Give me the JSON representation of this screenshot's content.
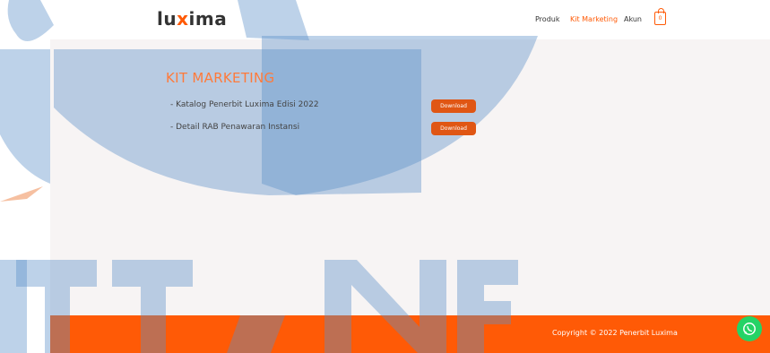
{
  "header": {
    "logo": {
      "prefix": "lu",
      "mark": "x",
      "suffix": "ima"
    },
    "nav": [
      {
        "label": "Produk"
      },
      {
        "label": "Kit Marketing"
      },
      {
        "label": "Akun"
      }
    ],
    "cart_count": "0"
  },
  "main": {
    "title": "KIT MARKETING",
    "items": [
      {
        "label": "- Katalog Penerbit Luxima Edisi 2022",
        "button": "Download"
      },
      {
        "label": "- Detail RAB Penawaran Instansi",
        "button": "Download"
      }
    ]
  },
  "footer": {
    "copyright": "Copyright © 2022 Penerbit Luxima"
  },
  "colors": {
    "accent": "#ff5a06",
    "panel": "#f7f4f4",
    "watermark": "#5b8fc9"
  },
  "icons": {
    "cart": "shopping-bag-icon",
    "chat": "whatsapp-icon"
  }
}
